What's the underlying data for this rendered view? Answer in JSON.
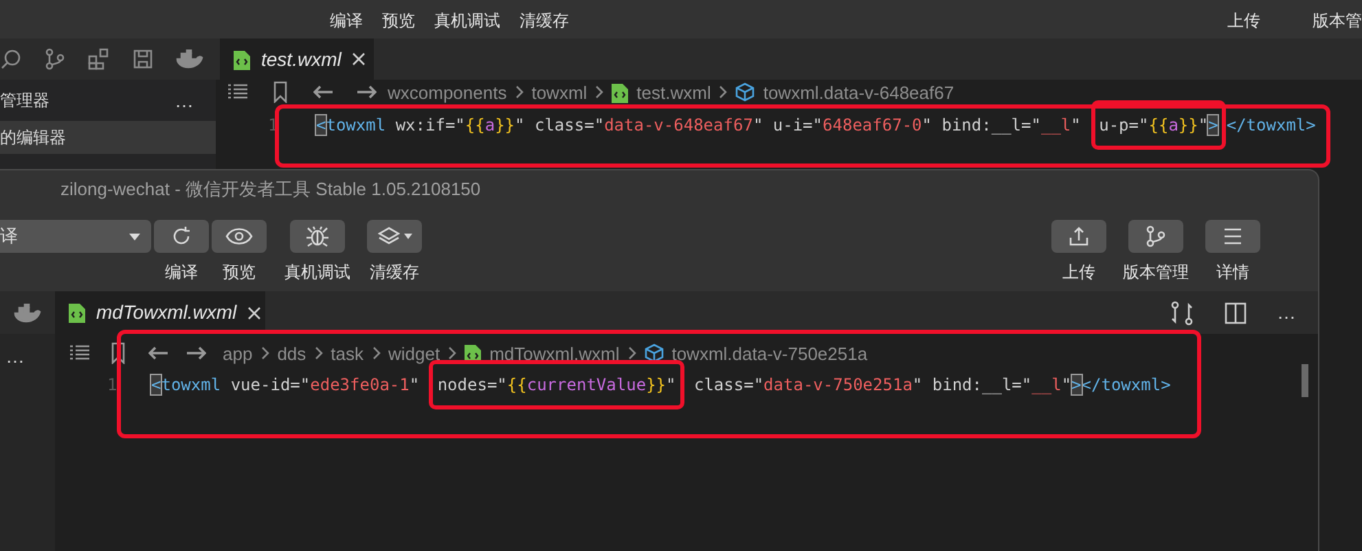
{
  "back_window": {
    "toolbar_labels": [
      "编译",
      "预览",
      "真机调试",
      "清缓存"
    ],
    "right_toolbar_labels": [
      "上传",
      "版本管"
    ],
    "tabs": [
      {
        "label": "test.wxml",
        "selected": true
      }
    ],
    "sidebar": {
      "title": "管理器",
      "more": "…",
      "items": [
        {
          "label": "的编辑器",
          "selected": true
        }
      ]
    },
    "breadcrumbs": [
      {
        "label": "wxcomponents",
        "kind": "folder"
      },
      {
        "label": "towxml",
        "kind": "folder"
      },
      {
        "label": "test.wxml",
        "kind": "file"
      },
      {
        "label": "towxml.data-v-648eaf67",
        "kind": "symbol"
      }
    ],
    "code_lines": [
      {
        "number": "1",
        "segments": [
          {
            "circled": false,
            "tokens": [
              {
                "kind": "tag",
                "text": "<",
                "boxed": true
              },
              {
                "kind": "tag",
                "text": "towxml"
              },
              {
                "kind": "attr",
                "text": " wx:if=\""
              },
              {
                "kind": "brace",
                "text": "{{"
              },
              {
                "kind": "var",
                "text": "a"
              },
              {
                "kind": "brace",
                "text": "}}"
              },
              {
                "kind": "attr",
                "text": "\" class=\""
              },
              {
                "kind": "string",
                "text": "data-v-648eaf67"
              },
              {
                "kind": "attr",
                "text": "\" u-i=\""
              },
              {
                "kind": "string",
                "text": "648eaf67-0"
              },
              {
                "kind": "attr",
                "text": "\" bind:__l=\""
              },
              {
                "kind": "string",
                "text": "__l"
              },
              {
                "kind": "attr",
                "text": "\" "
              }
            ]
          },
          {
            "circled": true,
            "tokens": [
              {
                "kind": "attr",
                "text": "u-p=\""
              },
              {
                "kind": "brace",
                "text": "{{"
              },
              {
                "kind": "var",
                "text": "a"
              },
              {
                "kind": "brace",
                "text": "}}"
              },
              {
                "kind": "attr",
                "text": "\""
              },
              {
                "kind": "tag",
                "text": ">",
                "boxed": true
              }
            ]
          },
          {
            "circled": false,
            "tokens": [
              {
                "kind": "tag",
                "text": "</towxml>"
              }
            ]
          }
        ]
      }
    ]
  },
  "front_window": {
    "title": "zilong-wechat - 微信开发者工具 Stable 1.05.2108150",
    "mode_select": "译",
    "toolbar": [
      {
        "label": "编译",
        "kind": "refresh"
      },
      {
        "label": "预览",
        "kind": "eye"
      },
      {
        "label": "真机调试",
        "kind": "bug"
      },
      {
        "label": "清缓存",
        "kind": "layers"
      }
    ],
    "right_toolbar": [
      {
        "label": "上传",
        "kind": "upload"
      },
      {
        "label": "版本管理",
        "kind": "branch"
      },
      {
        "label": "详情",
        "kind": "menu"
      }
    ],
    "sidebar_more": "…",
    "tabs": [
      {
        "label": "mdTowxml.wxml",
        "selected": true
      }
    ],
    "tab_bar_more": "…",
    "breadcrumbs": [
      {
        "label": "app",
        "kind": "folder"
      },
      {
        "label": "dds",
        "kind": "folder"
      },
      {
        "label": "task",
        "kind": "folder"
      },
      {
        "label": "widget",
        "kind": "folder"
      },
      {
        "label": "mdTowxml.wxml",
        "kind": "file"
      },
      {
        "label": "towxml.data-v-750e251a",
        "kind": "symbol"
      }
    ],
    "code_lines": [
      {
        "number": "1",
        "segments": [
          {
            "circled": false,
            "tokens": [
              {
                "kind": "tag",
                "text": "<",
                "boxed": true
              },
              {
                "kind": "tag",
                "text": "towxml"
              },
              {
                "kind": "attr",
                "text": " vue-id=\""
              },
              {
                "kind": "string",
                "text": "ede3fe0a-1"
              },
              {
                "kind": "attr",
                "text": "\" "
              }
            ]
          },
          {
            "circled": true,
            "tokens": [
              {
                "kind": "attr",
                "text": "nodes=\""
              },
              {
                "kind": "brace",
                "text": "{{"
              },
              {
                "kind": "var",
                "text": "currentValue"
              },
              {
                "kind": "brace",
                "text": "}}"
              },
              {
                "kind": "attr",
                "text": "\""
              }
            ]
          },
          {
            "circled": false,
            "tokens": [
              {
                "kind": "attr",
                "text": " class=\""
              },
              {
                "kind": "string",
                "text": "data-v-750e251a"
              },
              {
                "kind": "attr",
                "text": "\" bind:__l=\""
              },
              {
                "kind": "string",
                "text": "__l"
              },
              {
                "kind": "attr",
                "text": "\""
              },
              {
                "kind": "tag",
                "text": ">",
                "boxed": true
              },
              {
                "kind": "tag",
                "text": "</towxml>"
              }
            ]
          }
        ]
      }
    ]
  }
}
